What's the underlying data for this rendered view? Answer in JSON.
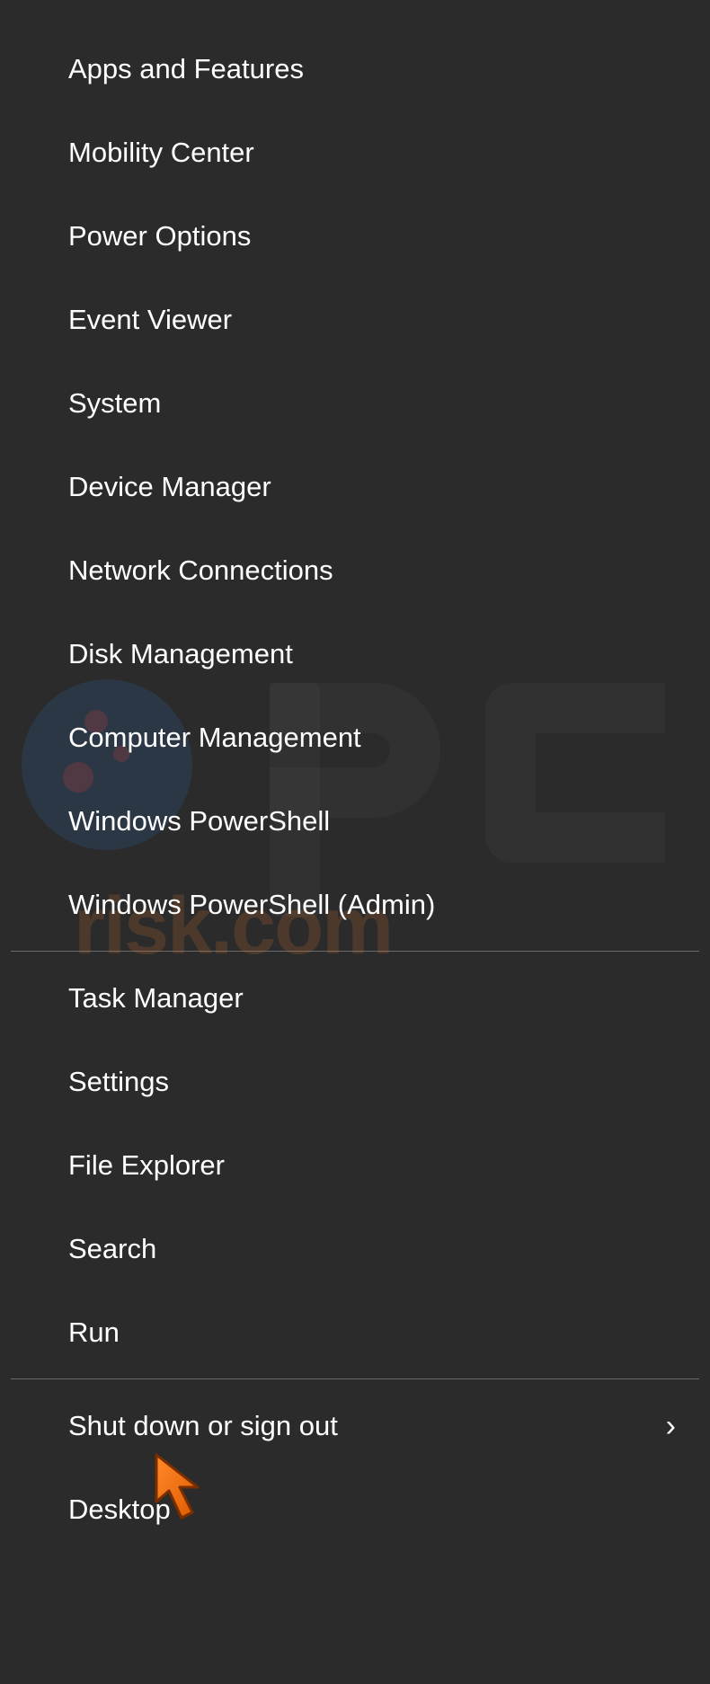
{
  "menu": {
    "group1": [
      "Apps and Features",
      "Mobility Center",
      "Power Options",
      "Event Viewer",
      "System",
      "Device Manager",
      "Network Connections",
      "Disk Management",
      "Computer Management",
      "Windows PowerShell",
      "Windows PowerShell (Admin)"
    ],
    "group2": [
      "Task Manager",
      "Settings",
      "File Explorer",
      "Search",
      "Run"
    ],
    "group3": [
      {
        "label": "Shut down or sign out",
        "submenu": true
      },
      {
        "label": "Desktop",
        "submenu": false
      }
    ]
  }
}
